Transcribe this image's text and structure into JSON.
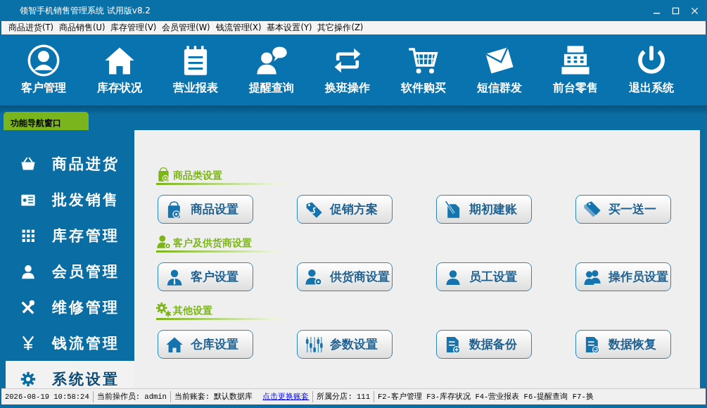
{
  "window": {
    "title": "领智手机销售管理系统 试用版v8.2"
  },
  "menu": [
    "商品进货(T)",
    "商品销售(U)",
    "库存管理(V)",
    "会员管理(W)",
    "钱流管理(X)",
    "基本设置(Y)",
    "其它操作(Z)"
  ],
  "toolbar": [
    "客户管理",
    "库存状况",
    "营业报表",
    "提醒查询",
    "换班操作",
    "软件购买",
    "短信群发",
    "前台零售",
    "退出系统"
  ],
  "nav_tab": {
    "label": "功能导航窗口",
    "selected": true
  },
  "sidebar": [
    {
      "label": "商品进货",
      "selected": false
    },
    {
      "label": "批发销售",
      "selected": false
    },
    {
      "label": "库存管理",
      "selected": false
    },
    {
      "label": "会员管理",
      "selected": false
    },
    {
      "label": "维修管理",
      "selected": false
    },
    {
      "label": "钱流管理",
      "selected": false
    },
    {
      "label": "系统设置",
      "selected": true
    }
  ],
  "sections": [
    {
      "title": "商品类设置",
      "buttons": [
        "商品设置",
        "促销方案",
        "期初建账",
        "买一送一"
      ]
    },
    {
      "title": "客户及供货商设置",
      "buttons": [
        "客户设置",
        "供货商设置",
        "员工设置",
        "操作员设置"
      ]
    },
    {
      "title": "其他设置",
      "buttons": [
        "仓库设置",
        "参数设置",
        "数据备份",
        "数据恢复"
      ]
    }
  ],
  "status_bar": {
    "time": "2026-08-19 10:58:24",
    "operator": "当前操作员: admin",
    "account": "当前账套: 默认数据库",
    "link": "点击更换账套",
    "branch": "所属分店: 111",
    "shortcuts": "F2-客户管理 F3-库存状况 F4-营业报表 F6-提醒查询 F7-换"
  }
}
